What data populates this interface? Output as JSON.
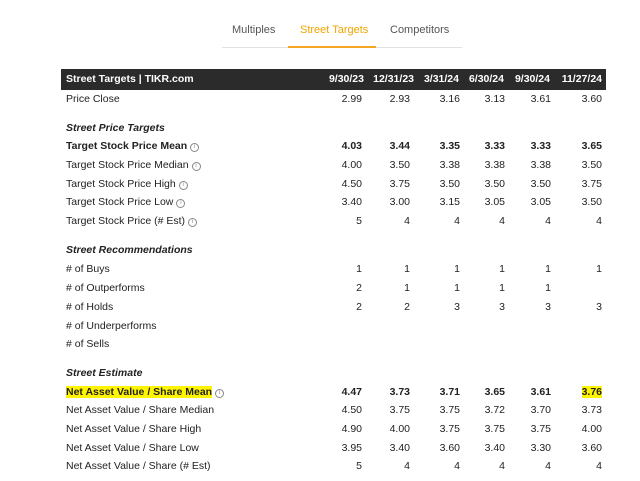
{
  "tabs": [
    "Multiples",
    "Street Targets",
    "Competitors"
  ],
  "active_tab": 1,
  "table": {
    "title": "Street Targets | TIKR.com",
    "dates": [
      "9/30/23",
      "12/31/23",
      "3/31/24",
      "6/30/24",
      "9/30/24",
      "11/27/24"
    ],
    "rows": [
      {
        "label": "Price Close",
        "values": [
          "2.99",
          "2.93",
          "3.16",
          "3.13",
          "3.61",
          "3.60"
        ]
      },
      {
        "label": "Street Price Targets",
        "section": true
      },
      {
        "label": "Target Stock Price Mean",
        "bold": true,
        "info": true,
        "values": [
          "4.03",
          "3.44",
          "3.35",
          "3.33",
          "3.33",
          "3.65"
        ]
      },
      {
        "label": "Target Stock Price Median",
        "info": true,
        "values": [
          "4.00",
          "3.50",
          "3.38",
          "3.38",
          "3.38",
          "3.50"
        ]
      },
      {
        "label": "Target Stock Price High",
        "info": true,
        "values": [
          "4.50",
          "3.75",
          "3.50",
          "3.50",
          "3.50",
          "3.75"
        ]
      },
      {
        "label": "Target Stock Price Low",
        "info": true,
        "values": [
          "3.40",
          "3.00",
          "3.15",
          "3.05",
          "3.05",
          "3.50"
        ]
      },
      {
        "label": "Target Stock Price (# Est)",
        "info": true,
        "values": [
          "5",
          "4",
          "4",
          "4",
          "4",
          "4"
        ]
      },
      {
        "label": "Street Recommendations",
        "section": true
      },
      {
        "label": "# of Buys",
        "values": [
          "1",
          "1",
          "1",
          "1",
          "1",
          "1"
        ]
      },
      {
        "label": "# of Outperforms",
        "values": [
          "2",
          "1",
          "1",
          "1",
          "1",
          ""
        ]
      },
      {
        "label": "# of Holds",
        "values": [
          "2",
          "2",
          "3",
          "3",
          "3",
          "3"
        ]
      },
      {
        "label": "# of Underperforms",
        "values": [
          "",
          "",
          "",
          "",
          "",
          ""
        ]
      },
      {
        "label": "# of Sells",
        "values": [
          "",
          "",
          "",
          "",
          "",
          ""
        ]
      },
      {
        "label": "Street Estimate",
        "section": true
      },
      {
        "label": "Net Asset Value / Share Mean",
        "bold": true,
        "info": true,
        "highlight": true,
        "values": [
          "4.47",
          "3.73",
          "3.71",
          "3.65",
          "3.61",
          "3.76"
        ]
      },
      {
        "label": "Net Asset Value / Share Median",
        "values": [
          "4.50",
          "3.75",
          "3.75",
          "3.72",
          "3.70",
          "3.73"
        ]
      },
      {
        "label": "Net Asset Value / Share High",
        "values": [
          "4.90",
          "4.00",
          "3.75",
          "3.75",
          "3.75",
          "4.00"
        ]
      },
      {
        "label": "Net Asset Value / Share Low",
        "values": [
          "3.95",
          "3.40",
          "3.60",
          "3.40",
          "3.30",
          "3.60"
        ]
      },
      {
        "label": "Net Asset Value / Share (# Est)",
        "values": [
          "5",
          "4",
          "4",
          "4",
          "4",
          "4"
        ]
      }
    ]
  },
  "colors": {
    "accent": "#f5a623",
    "header_bg": "#2b2b2b",
    "highlight": "#fff500"
  }
}
